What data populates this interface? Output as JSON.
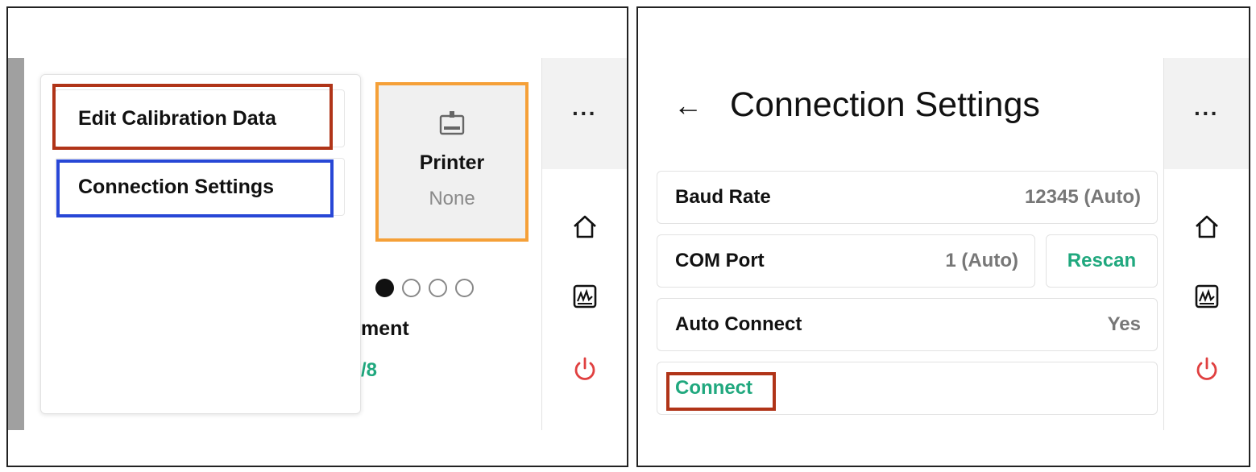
{
  "left_panel": {
    "menu": {
      "edit_calibration": "Edit Calibration Data",
      "connection_settings": "Connection Settings"
    },
    "printer_card": {
      "label": "Printer",
      "value": "None"
    },
    "carousel": {
      "total_pages": 4,
      "active_page": 1
    },
    "partial_label": "ment",
    "partial_value": "/8"
  },
  "right_panel": {
    "title": "Connection Settings",
    "rows": {
      "baud_rate": {
        "label": "Baud Rate",
        "value": "12345 (Auto)"
      },
      "com_port": {
        "label": "COM Port",
        "value": "1 (Auto)"
      },
      "rescan": "Rescan",
      "auto_connect": {
        "label": "Auto Connect",
        "value": "Yes"
      },
      "connect": "Connect"
    }
  },
  "sidebar": {
    "icons": [
      "more-icon",
      "home-icon",
      "graph-icon",
      "power-icon"
    ],
    "more_label": "···"
  },
  "colors": {
    "accent_green": "#20a87e",
    "highlight_red": "#b03418",
    "highlight_blue": "#2847d6",
    "highlight_orange": "#f5a038",
    "power_red": "#e04040"
  }
}
